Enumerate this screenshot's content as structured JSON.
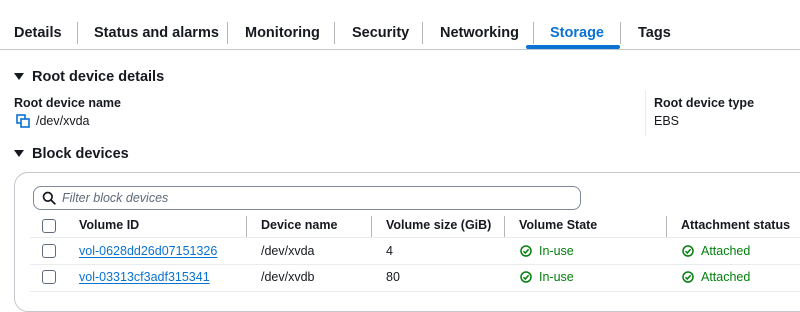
{
  "tabs": [
    "Details",
    "Status and alarms",
    "Monitoring",
    "Security",
    "Networking",
    "Storage",
    "Tags"
  ],
  "active_tab": "Storage",
  "root_device": {
    "section_title": "Root device details",
    "name_label": "Root device name",
    "name_value": "/dev/xvda",
    "type_label": "Root device type",
    "type_value": "EBS"
  },
  "block_devices": {
    "section_title": "Block devices",
    "filter_placeholder": "Filter block devices",
    "columns": [
      "Volume ID",
      "Device name",
      "Volume size (GiB)",
      "Volume State",
      "Attachment status"
    ],
    "rows": [
      {
        "volume_id": "vol-0628dd26d07151326",
        "device_name": "/dev/xvda",
        "size": "4",
        "state": "In-use",
        "attachment": "Attached"
      },
      {
        "volume_id": "vol-03313cf3adf315341",
        "device_name": "/dev/xvdb",
        "size": "80",
        "state": "In-use",
        "attachment": "Attached"
      }
    ]
  },
  "colors": {
    "accent": "#0972d3",
    "success": "#037f0c",
    "text": "#16191f"
  },
  "icons": {
    "copy": "copy-icon",
    "search": "search-icon",
    "caret": "caret-down-icon",
    "status": "check-circle-icon"
  }
}
